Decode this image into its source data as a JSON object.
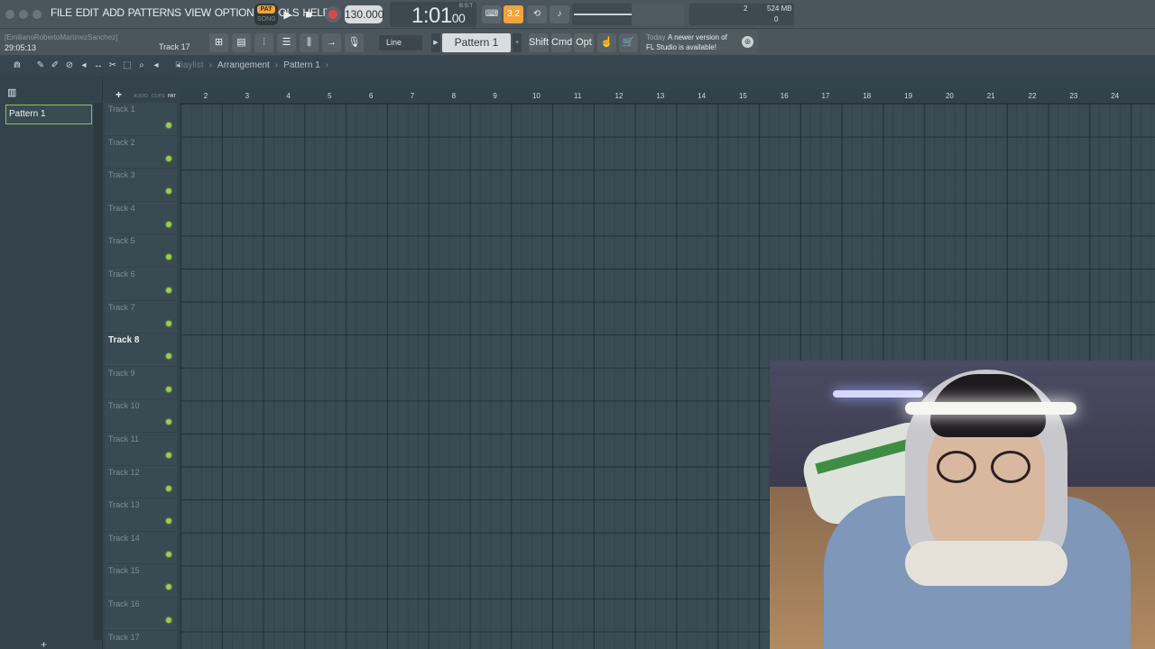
{
  "menu": [
    "FILE",
    "EDIT",
    "ADD",
    "PATTERNS",
    "VIEW",
    "OPTIONS",
    "TOOLS",
    "HELP"
  ],
  "transport": {
    "pat_label": "PAT",
    "song_label": "SONG",
    "tempo": "130.000",
    "time": "1:01",
    "time_small": "00",
    "bst_label": "B:S:T"
  },
  "top_icons": {
    "snap_label": "3.2"
  },
  "meter": {
    "voices": "2",
    "ram": "524 MB",
    "cpu": "0"
  },
  "session": {
    "user_hint": "[EmilianoRobertoMartinezSanchez]",
    "clock": "29:05:13",
    "track_label": "Track 17"
  },
  "snap_select": "Line",
  "pattern_select": "Pattern 1",
  "keys": {
    "shift": "Shift",
    "cmd": "Cmd",
    "opt": "Opt"
  },
  "news": {
    "today": "Today",
    "line1": "A newer version of",
    "line2": "FL Studio is available!"
  },
  "breadcrumbs": {
    "playlist": "Playlist",
    "sep": "›",
    "arrangement": "Arrangement",
    "pattern": "Pattern 1"
  },
  "picker": {
    "items": [
      "Pattern 1"
    ]
  },
  "track_header": {
    "mini1": "AUDIO",
    "mini2": "CLIPS",
    "mini3": "PAT"
  },
  "tracks": [
    "Track 1",
    "Track 2",
    "Track 3",
    "Track 4",
    "Track 5",
    "Track 6",
    "Track 7",
    "Track 8",
    "Track 9",
    "Track 10",
    "Track 11",
    "Track 12",
    "Track 13",
    "Track 14",
    "Track 15",
    "Track 16",
    "Track 17"
  ],
  "selected_track": "Track 8",
  "ruler": [
    "2",
    "3",
    "4",
    "5",
    "6",
    "7",
    "8",
    "9",
    "10",
    "11",
    "12",
    "13",
    "14",
    "15",
    "16",
    "17",
    "18",
    "19",
    "20",
    "21",
    "22",
    "23",
    "24"
  ],
  "colors": {
    "accent": "#f0a43a",
    "led": "#92d14a",
    "grid": "#3a4b53"
  }
}
